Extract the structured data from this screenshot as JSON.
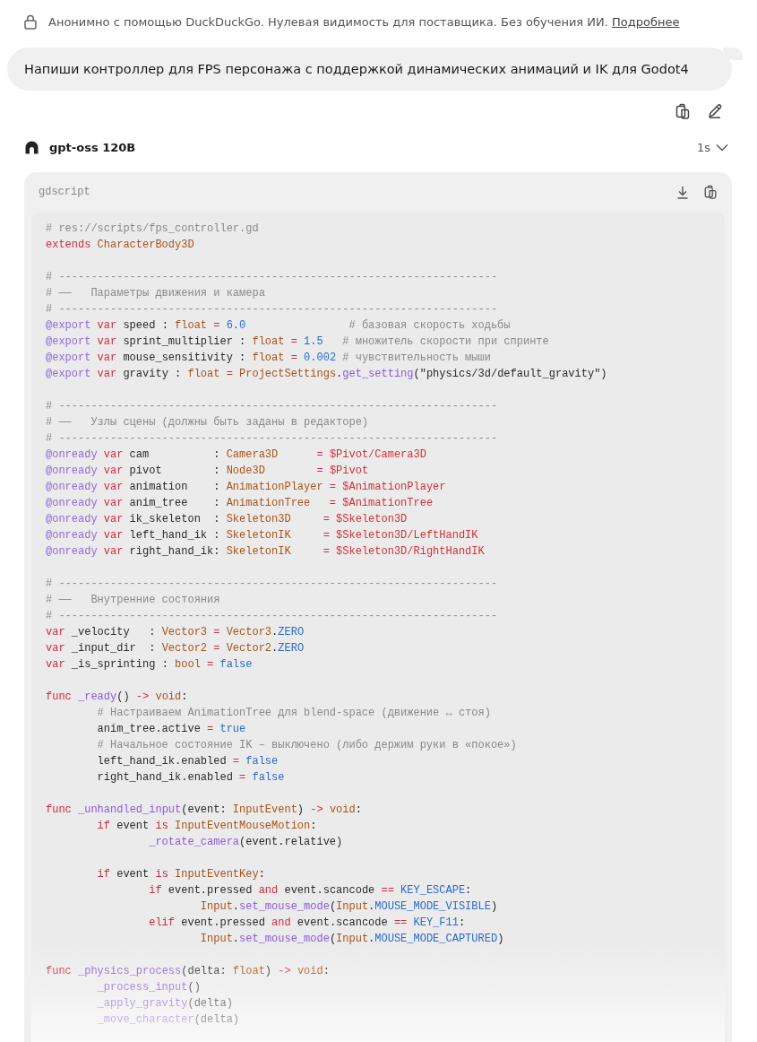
{
  "privacy_notice": {
    "text": "Анонимно с помощью DuckDuckGo. Нулевая видимость для поставщика. Без обучения ИИ.",
    "link": "Подробнее"
  },
  "user_message": {
    "text": "Напиши контроллер для FPS персонажа с поддержкой динамических анимаций и IK для Godot4"
  },
  "response": {
    "model": "gpt-oss 120B",
    "duration": "1s",
    "expanded": false
  },
  "code_block": {
    "language": "gdscript",
    "blocks": [
      [
        [
          {
            "kind": "comment",
            "text": "# res://scripts/fps_controller.gd"
          }
        ],
        [
          {
            "kind": "keyword",
            "text": "extends "
          },
          {
            "kind": "type",
            "text": "CharacterBody3D"
          }
        ]
      ],
      [
        [
          {
            "kind": "comment",
            "text": "# --------------------------------------------------------------------"
          }
        ],
        [
          {
            "kind": "comment",
            "text": "# ——   Параметры движения и камера"
          }
        ],
        [
          {
            "kind": "comment",
            "text": "# --------------------------------------------------------------------"
          }
        ],
        [
          {
            "kind": "annotation",
            "text": "@export "
          },
          {
            "kind": "keyword",
            "text": "var"
          },
          {
            "kind": "plain",
            "text": " speed : "
          },
          {
            "kind": "type",
            "text": "float "
          },
          {
            "kind": "keyword",
            "text": "= "
          },
          {
            "kind": "constant",
            "text": "6.0                "
          },
          {
            "kind": "comment",
            "text": "# базовая скорость ходьбы"
          }
        ],
        [
          {
            "kind": "annotation",
            "text": "@export "
          },
          {
            "kind": "keyword",
            "text": "var"
          },
          {
            "kind": "plain",
            "text": " sprint_multiplier : "
          },
          {
            "kind": "type",
            "text": "float "
          },
          {
            "kind": "keyword",
            "text": "= "
          },
          {
            "kind": "constant",
            "text": "1.5   "
          },
          {
            "kind": "comment",
            "text": "# множитель скорости при спринте"
          }
        ],
        [
          {
            "kind": "annotation",
            "text": "@export "
          },
          {
            "kind": "keyword",
            "text": "var"
          },
          {
            "kind": "plain",
            "text": " mouse_sensitivity : "
          },
          {
            "kind": "type",
            "text": "float "
          },
          {
            "kind": "keyword",
            "text": "= "
          },
          {
            "kind": "constant",
            "text": "0.002 "
          },
          {
            "kind": "comment",
            "text": "# чувствительность мыши"
          }
        ],
        [
          {
            "kind": "annotation",
            "text": "@export "
          },
          {
            "kind": "keyword",
            "text": "var"
          },
          {
            "kind": "plain",
            "text": " gravity : "
          },
          {
            "kind": "type",
            "text": "float "
          },
          {
            "kind": "keyword",
            "text": "= "
          },
          {
            "kind": "type",
            "text": "ProjectSettings"
          },
          {
            "kind": "plain",
            "text": "."
          },
          {
            "kind": "function",
            "text": "get_setting"
          },
          {
            "kind": "plain",
            "text": "(\"physics/3d/default_gravity\")"
          }
        ]
      ],
      [
        [
          {
            "kind": "comment",
            "text": "# --------------------------------------------------------------------"
          }
        ],
        [
          {
            "kind": "comment",
            "text": "# ——   Узлы сцены (должны быть заданы в редакторе)"
          }
        ],
        [
          {
            "kind": "comment",
            "text": "# --------------------------------------------------------------------"
          }
        ],
        [
          {
            "kind": "annotation",
            "text": "@onready "
          },
          {
            "kind": "keyword",
            "text": "var"
          },
          {
            "kind": "plain",
            "text": " cam          : "
          },
          {
            "kind": "type",
            "text": "Camera3D      "
          },
          {
            "kind": "keyword",
            "text": "= "
          },
          {
            "kind": "path",
            "text": "$Pivot/Camera3D"
          }
        ],
        [
          {
            "kind": "annotation",
            "text": "@onready "
          },
          {
            "kind": "keyword",
            "text": "var"
          },
          {
            "kind": "plain",
            "text": " pivot        : "
          },
          {
            "kind": "type",
            "text": "Node3D        "
          },
          {
            "kind": "keyword",
            "text": "= "
          },
          {
            "kind": "path",
            "text": "$Pivot"
          }
        ],
        [
          {
            "kind": "annotation",
            "text": "@onready "
          },
          {
            "kind": "keyword",
            "text": "var"
          },
          {
            "kind": "plain",
            "text": " animation    : "
          },
          {
            "kind": "type",
            "text": "AnimationPlayer "
          },
          {
            "kind": "keyword",
            "text": "= "
          },
          {
            "kind": "path",
            "text": "$AnimationPlayer"
          }
        ],
        [
          {
            "kind": "annotation",
            "text": "@onready "
          },
          {
            "kind": "keyword",
            "text": "var"
          },
          {
            "kind": "plain",
            "text": " anim_tree    : "
          },
          {
            "kind": "type",
            "text": "AnimationTree   "
          },
          {
            "kind": "keyword",
            "text": "= "
          },
          {
            "kind": "path",
            "text": "$AnimationTree"
          }
        ],
        [
          {
            "kind": "annotation",
            "text": "@onready "
          },
          {
            "kind": "keyword",
            "text": "var"
          },
          {
            "kind": "plain",
            "text": " ik_skeleton  : "
          },
          {
            "kind": "type",
            "text": "Skeleton3D     "
          },
          {
            "kind": "keyword",
            "text": "= "
          },
          {
            "kind": "path",
            "text": "$Skeleton3D"
          }
        ],
        [
          {
            "kind": "annotation",
            "text": "@onready "
          },
          {
            "kind": "keyword",
            "text": "var"
          },
          {
            "kind": "plain",
            "text": " left_hand_ik : "
          },
          {
            "kind": "type",
            "text": "SkeletonIK     "
          },
          {
            "kind": "keyword",
            "text": "= "
          },
          {
            "kind": "path",
            "text": "$Skeleton3D/LeftHandIK"
          }
        ],
        [
          {
            "kind": "annotation",
            "text": "@onready "
          },
          {
            "kind": "keyword",
            "text": "var"
          },
          {
            "kind": "plain",
            "text": " right_hand_ik: "
          },
          {
            "kind": "type",
            "text": "SkeletonIK     "
          },
          {
            "kind": "keyword",
            "text": "= "
          },
          {
            "kind": "path",
            "text": "$Skeleton3D/RightHandIK"
          }
        ]
      ],
      [
        [
          {
            "kind": "comment",
            "text": "# --------------------------------------------------------------------"
          }
        ],
        [
          {
            "kind": "comment",
            "text": "# ——   Внутренние состояния"
          }
        ],
        [
          {
            "kind": "comment",
            "text": "# --------------------------------------------------------------------"
          }
        ],
        [
          {
            "kind": "keyword",
            "text": "var"
          },
          {
            "kind": "plain",
            "text": " _velocity   : "
          },
          {
            "kind": "type",
            "text": "Vector3 "
          },
          {
            "kind": "keyword",
            "text": "= "
          },
          {
            "kind": "type",
            "text": "Vector3"
          },
          {
            "kind": "plain",
            "text": "."
          },
          {
            "kind": "constant",
            "text": "ZERO"
          }
        ],
        [
          {
            "kind": "keyword",
            "text": "var"
          },
          {
            "kind": "plain",
            "text": " _input_dir  : "
          },
          {
            "kind": "type",
            "text": "Vector2 "
          },
          {
            "kind": "keyword",
            "text": "= "
          },
          {
            "kind": "type",
            "text": "Vector2"
          },
          {
            "kind": "plain",
            "text": "."
          },
          {
            "kind": "constant",
            "text": "ZERO"
          }
        ],
        [
          {
            "kind": "keyword",
            "text": "var"
          },
          {
            "kind": "plain",
            "text": " _is_sprinting : "
          },
          {
            "kind": "type",
            "text": "bool "
          },
          {
            "kind": "keyword",
            "text": "= "
          },
          {
            "kind": "constant",
            "text": "false"
          }
        ]
      ],
      [
        [
          {
            "kind": "keyword",
            "text": "func "
          },
          {
            "kind": "function",
            "text": "_ready"
          },
          {
            "kind": "plain",
            "text": "() "
          },
          {
            "kind": "keyword",
            "text": "-> "
          },
          {
            "kind": "type",
            "text": "void"
          },
          {
            "kind": "plain",
            "text": ":"
          }
        ],
        [
          {
            "kind": "comment",
            "text": "        # Настраиваем AnimationTree для blend-space (движение ↔ стоя)"
          }
        ],
        [
          {
            "kind": "plain",
            "text": "        anim_tree.active "
          },
          {
            "kind": "keyword",
            "text": "= "
          },
          {
            "kind": "constant",
            "text": "true"
          }
        ],
        [
          {
            "kind": "comment",
            "text": "        # Начальное состояние IK – выключено (либо держим руки в «покое»)"
          }
        ],
        [
          {
            "kind": "plain",
            "text": "        left_hand_ik.enabled "
          },
          {
            "kind": "keyword",
            "text": "= "
          },
          {
            "kind": "constant",
            "text": "false"
          }
        ],
        [
          {
            "kind": "plain",
            "text": "        right_hand_ik.enabled "
          },
          {
            "kind": "keyword",
            "text": "= "
          },
          {
            "kind": "constant",
            "text": "false"
          }
        ]
      ],
      [
        [
          {
            "kind": "keyword",
            "text": "func "
          },
          {
            "kind": "function",
            "text": "_unhandled_input"
          },
          {
            "kind": "plain",
            "text": "(event: "
          },
          {
            "kind": "type",
            "text": "InputEvent"
          },
          {
            "kind": "plain",
            "text": ") "
          },
          {
            "kind": "keyword",
            "text": "-> "
          },
          {
            "kind": "type",
            "text": "void"
          },
          {
            "kind": "plain",
            "text": ":"
          }
        ],
        [
          {
            "kind": "keyword",
            "text": "        if"
          },
          {
            "kind": "plain",
            "text": " event "
          },
          {
            "kind": "keyword",
            "text": "is "
          },
          {
            "kind": "type",
            "text": "InputEventMouseMotion"
          },
          {
            "kind": "plain",
            "text": ":"
          }
        ],
        [
          {
            "kind": "function",
            "text": "                _rotate_camera"
          },
          {
            "kind": "plain",
            "text": "(event.relative)"
          }
        ]
      ],
      [
        [
          {
            "kind": "keyword",
            "text": "        if"
          },
          {
            "kind": "plain",
            "text": " event "
          },
          {
            "kind": "keyword",
            "text": "is "
          },
          {
            "kind": "type",
            "text": "InputEventKey"
          },
          {
            "kind": "plain",
            "text": ":"
          }
        ],
        [
          {
            "kind": "keyword",
            "text": "                if"
          },
          {
            "kind": "plain",
            "text": " event.pressed "
          },
          {
            "kind": "keyword",
            "text": "and"
          },
          {
            "kind": "plain",
            "text": " event.scancode "
          },
          {
            "kind": "keyword",
            "text": "== "
          },
          {
            "kind": "constant",
            "text": "KEY_ESCAPE"
          },
          {
            "kind": "plain",
            "text": ":"
          }
        ],
        [
          {
            "kind": "type",
            "text": "                        Input"
          },
          {
            "kind": "plain",
            "text": "."
          },
          {
            "kind": "function",
            "text": "set_mouse_mode"
          },
          {
            "kind": "plain",
            "text": "("
          },
          {
            "kind": "type",
            "text": "Input"
          },
          {
            "kind": "plain",
            "text": "."
          },
          {
            "kind": "constant",
            "text": "MOUSE_MODE_VISIBLE"
          },
          {
            "kind": "plain",
            "text": ")"
          }
        ],
        [
          {
            "kind": "keyword",
            "text": "                elif"
          },
          {
            "kind": "plain",
            "text": " event.pressed "
          },
          {
            "kind": "keyword",
            "text": "and"
          },
          {
            "kind": "plain",
            "text": " event.scancode "
          },
          {
            "kind": "keyword",
            "text": "== "
          },
          {
            "kind": "constant",
            "text": "KEY_F11"
          },
          {
            "kind": "plain",
            "text": ":"
          }
        ],
        [
          {
            "kind": "type",
            "text": "                        Input"
          },
          {
            "kind": "plain",
            "text": "."
          },
          {
            "kind": "function",
            "text": "set_mouse_mode"
          },
          {
            "kind": "plain",
            "text": "("
          },
          {
            "kind": "type",
            "text": "Input"
          },
          {
            "kind": "plain",
            "text": "."
          },
          {
            "kind": "constant",
            "text": "MOUSE_MODE_CAPTURED"
          },
          {
            "kind": "plain",
            "text": ")"
          }
        ]
      ],
      [
        [
          {
            "kind": "keyword",
            "text": "func "
          },
          {
            "kind": "function",
            "text": "_physics_process"
          },
          {
            "kind": "plain",
            "text": "(delta: "
          },
          {
            "kind": "type",
            "text": "float"
          },
          {
            "kind": "plain",
            "text": ") "
          },
          {
            "kind": "keyword",
            "text": "-> "
          },
          {
            "kind": "type",
            "text": "void"
          },
          {
            "kind": "plain",
            "text": ":"
          }
        ],
        [
          {
            "kind": "function",
            "text": "        _process_input"
          },
          {
            "kind": "plain",
            "text": "()"
          }
        ],
        [
          {
            "kind": "function",
            "text": "        _apply_gravity"
          },
          {
            "kind": "plain",
            "text": "(delta)"
          }
        ],
        [
          {
            "kind": "function",
            "text": "        _move_character"
          },
          {
            "kind": "plain",
            "text": "(delta)"
          }
        ]
      ]
    ]
  }
}
